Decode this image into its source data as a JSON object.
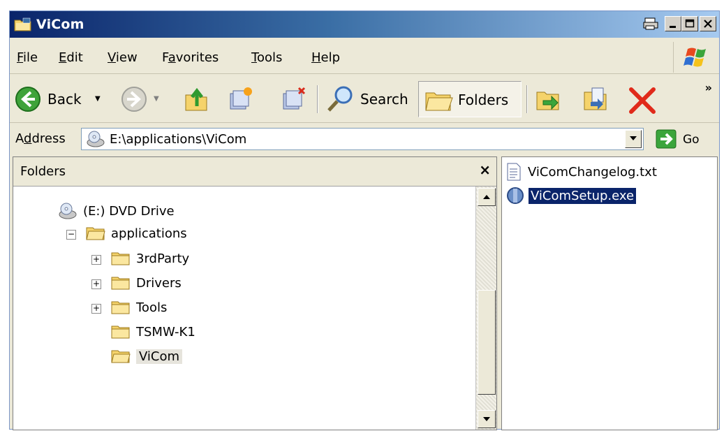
{
  "window": {
    "title": "ViCom"
  },
  "menu": {
    "items": [
      {
        "label": "File",
        "ul": "F",
        "rest": "ile"
      },
      {
        "label": "Edit",
        "ul": "E",
        "rest": "dit"
      },
      {
        "label": "View",
        "ul": "V",
        "rest": "iew"
      },
      {
        "label": "Favorites",
        "pre": "F",
        "ul": "a",
        "rest": "vorites"
      },
      {
        "label": "Tools",
        "ul": "T",
        "rest": "ools"
      },
      {
        "label": "Help",
        "ul": "H",
        "rest": "elp"
      }
    ]
  },
  "toolbar": {
    "back_label": "Back",
    "search_label": "Search",
    "folders_label": "Folders",
    "chevron": "»"
  },
  "address": {
    "label_pre": "A",
    "label_ul": "d",
    "label_rest": "dress",
    "value": "E:\\applications\\ViCom",
    "go_label": "Go"
  },
  "folders_pane": {
    "title": "Folders",
    "close": "×",
    "tree": [
      {
        "label": "(E:) DVD Drive"
      },
      {
        "label": "applications",
        "expander": "−"
      },
      {
        "label": "3rdParty",
        "expander": "+"
      },
      {
        "label": "Drivers",
        "expander": "+"
      },
      {
        "label": "Tools",
        "expander": "+"
      },
      {
        "label": "TSMW-K1"
      },
      {
        "label": "ViCom"
      }
    ]
  },
  "files": [
    {
      "name": "ViComChangelog.txt",
      "icon": "text-file-icon"
    },
    {
      "name": "ViComSetup.exe",
      "icon": "setup-exe-icon",
      "selected": true
    }
  ],
  "colors": {
    "title_gradient_start": "#0a246a",
    "title_gradient_end": "#a6caf0",
    "selection": "#0a246a",
    "chrome": "#ece9d8"
  }
}
